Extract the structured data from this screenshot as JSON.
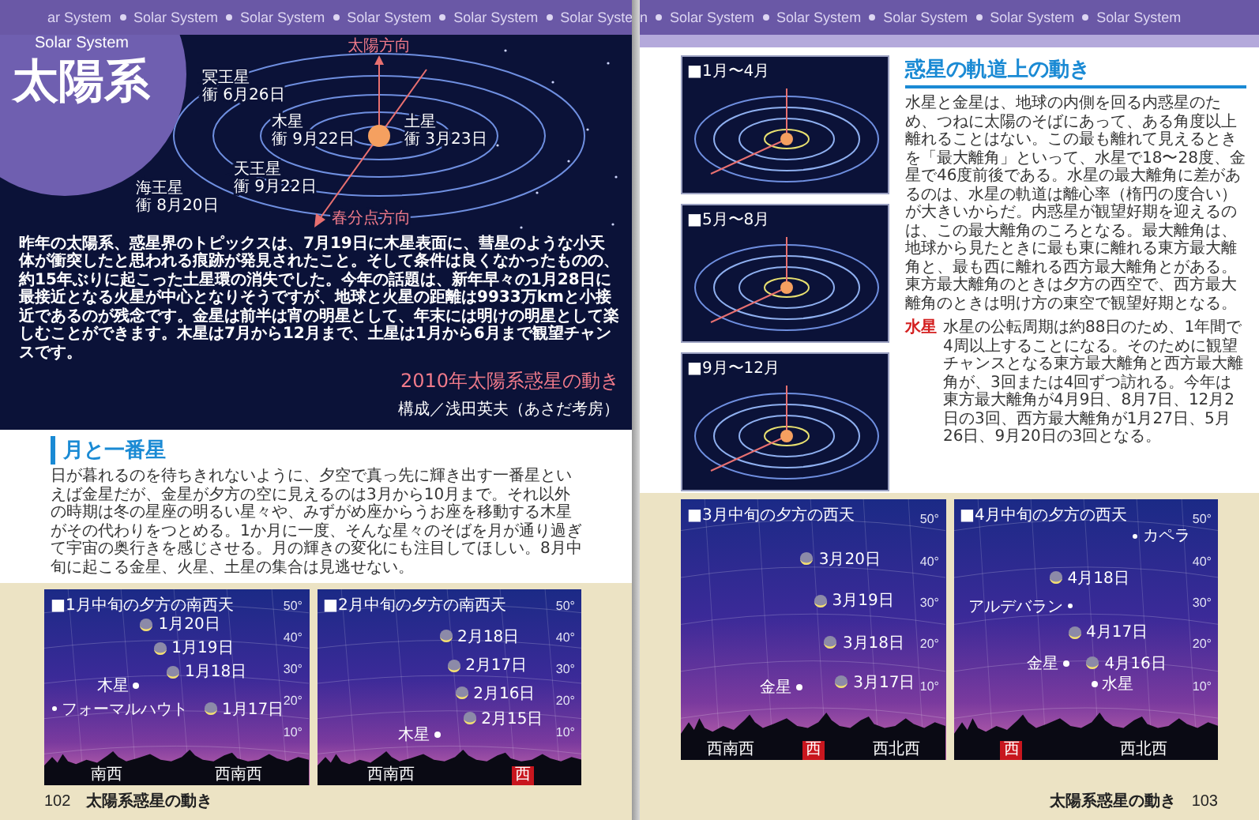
{
  "left_page": {
    "header_band": [
      "ar System",
      "Solar System",
      "Solar System",
      "Solar System",
      "Solar System",
      "Solar Syste"
    ],
    "badge": {
      "subtitle": "Solar System",
      "title": "太陽系"
    },
    "orbit_diagram": {
      "sun_direction": "太陽方向",
      "equinox_direction": "春分点方向",
      "planets": [
        {
          "name": "冥王星",
          "opposition": "衝 6月26日"
        },
        {
          "name": "木星",
          "opposition": "衝 9月22日"
        },
        {
          "name": "土星",
          "opposition": "衝 3月23日"
        },
        {
          "name": "天王星",
          "opposition": "衝 9月22日"
        },
        {
          "name": "海王星",
          "opposition": "衝 8月20日"
        }
      ]
    },
    "intro": "昨年の太陽系、惑星界のトピックスは、7月19日に木星表面に、彗星のような小天体が衝突したと思われる痕跡が発見されたこと。そして条件は良くなかったものの、約15年ぶりに起こった土星環の消失でした。今年の話題は、新年早々の1月28日に最接近となる火星が中心となりそうですが、地球と火星の距離は9933万kmと小接近であるのが残念です。金星は前半は宵の明星として、年末には明けの明星として楽しむことができます。木星は7月から12月まで、土星は1月から6月まで観望チャンスです。",
    "title": "2010年太陽系惑星の動き",
    "credit": "構成／浅田英夫（あさだ考房）",
    "section": {
      "heading": "月と一番星",
      "body": "日が暮れるのを待ちきれないように、夕空で真っ先に輝き出す一番星といえば金星だが、金星が夕方の空に見えるのは3月から10月まで。それ以外の時期は冬の星座の明るい星々や、みずがめ座からうお座を移動する木星がその代わりをつとめる。1か月に一度、そんな星々のそばを月が通り過ぎて宇宙の奥行きを感じさせる。月の輝きの変化にも注目してほしい。8月中旬に起こる金星、火星、土星の集合は見逃せない。"
    },
    "sky_charts": [
      {
        "title": "■1月中旬の夕方の南西天",
        "altitude_ticks": [
          "50°",
          "40°",
          "30°",
          "20°",
          "10°"
        ],
        "objects": [
          {
            "kind": "moon",
            "label": "1月20日"
          },
          {
            "kind": "moon",
            "label": "1月19日"
          },
          {
            "kind": "moon",
            "label": "1月18日"
          },
          {
            "kind": "planet",
            "label": "木星"
          },
          {
            "kind": "star",
            "label": "フォーマルハウト"
          },
          {
            "kind": "moon",
            "label": "1月17日"
          }
        ],
        "horizon": [
          {
            "label": "南西",
            "highlight": false
          },
          {
            "label": "西南西",
            "highlight": false
          }
        ]
      },
      {
        "title": "■2月中旬の夕方の南西天",
        "altitude_ticks": [
          "50°",
          "40°",
          "30°",
          "20°",
          "10°"
        ],
        "objects": [
          {
            "kind": "moon",
            "label": "2月18日"
          },
          {
            "kind": "moon",
            "label": "2月17日"
          },
          {
            "kind": "moon",
            "label": "2月16日"
          },
          {
            "kind": "moon",
            "label": "2月15日"
          },
          {
            "kind": "planet",
            "label": "木星"
          }
        ],
        "horizon": [
          {
            "label": "西南西",
            "highlight": false
          },
          {
            "label": "西",
            "highlight": true
          }
        ]
      }
    ],
    "footer": {
      "page_number": "102",
      "title": "太陽系惑星の動き"
    }
  },
  "right_page": {
    "header_band": [
      "n",
      "Solar System",
      "Solar System",
      "Solar System",
      "Solar System",
      "Solar System"
    ],
    "orbit_panels": [
      {
        "title": "■1月〜4月"
      },
      {
        "title": "■5月〜8月"
      },
      {
        "title": "■9月〜12月"
      }
    ],
    "article": {
      "heading": "惑星の軌道上の動き",
      "body": "水星と金星は、地球の内側を回る内惑星のため、つねに太陽のそばにあって、ある角度以上離れることはない。この最も離れて見えるときを「最大離角」といって、水星で18〜28度、金星で46度前後である。水星の最大離角に差があるのは、水星の軌道は離心率（楕円の度合い）が大きいからだ。内惑星が観望好期を迎えるのは、この最大離角のころとなる。最大離角は、地球から見たときに最も東に離れる東方最大離角と、最も西に離れる西方最大離角とがある。東方最大離角のときは夕方の西空で、西方最大離角のときは明け方の東空で観望好期となる。",
      "planets": [
        {
          "name": "水星",
          "text": "水星の公転周期は約88日のため、1年間で4周以上することになる。そのために観望チャンスとなる東方最大離角と西方最大離角が、3回または4回ずつ訪れる。今年は東方最大離角が4月9日、8月7日、12月2日の3回、西方最大離角が1月27日、5月26日、9月20日の3回となる。"
        }
      ]
    },
    "sky_charts": [
      {
        "title": "■3月中旬の夕方の西天",
        "altitude_ticks": [
          "50°",
          "40°",
          "30°",
          "20°",
          "10°"
        ],
        "objects": [
          {
            "kind": "moon",
            "label": "3月20日"
          },
          {
            "kind": "moon",
            "label": "3月19日"
          },
          {
            "kind": "moon",
            "label": "3月18日"
          },
          {
            "kind": "moon",
            "label": "3月17日"
          },
          {
            "kind": "planet",
            "label": "金星"
          }
        ],
        "horizon": [
          {
            "label": "西南西",
            "highlight": false
          },
          {
            "label": "西",
            "highlight": true
          },
          {
            "label": "西北西",
            "highlight": false
          }
        ]
      },
      {
        "title": "■4月中旬の夕方の西天",
        "altitude_ticks": [
          "50°",
          "40°",
          "30°",
          "20°",
          "10°"
        ],
        "objects": [
          {
            "kind": "star",
            "label": "カペラ"
          },
          {
            "kind": "moon",
            "label": "4月18日"
          },
          {
            "kind": "star",
            "label": "アルデバラン"
          },
          {
            "kind": "moon",
            "label": "4月17日"
          },
          {
            "kind": "planet",
            "label": "金星"
          },
          {
            "kind": "moon",
            "label": "4月16日"
          },
          {
            "kind": "planet",
            "label": "水星"
          }
        ],
        "horizon": [
          {
            "label": "西",
            "highlight": true
          },
          {
            "label": "西北西",
            "highlight": false
          }
        ]
      }
    ],
    "footer": {
      "title": "太陽系惑星の動き",
      "page_number": "103"
    }
  }
}
